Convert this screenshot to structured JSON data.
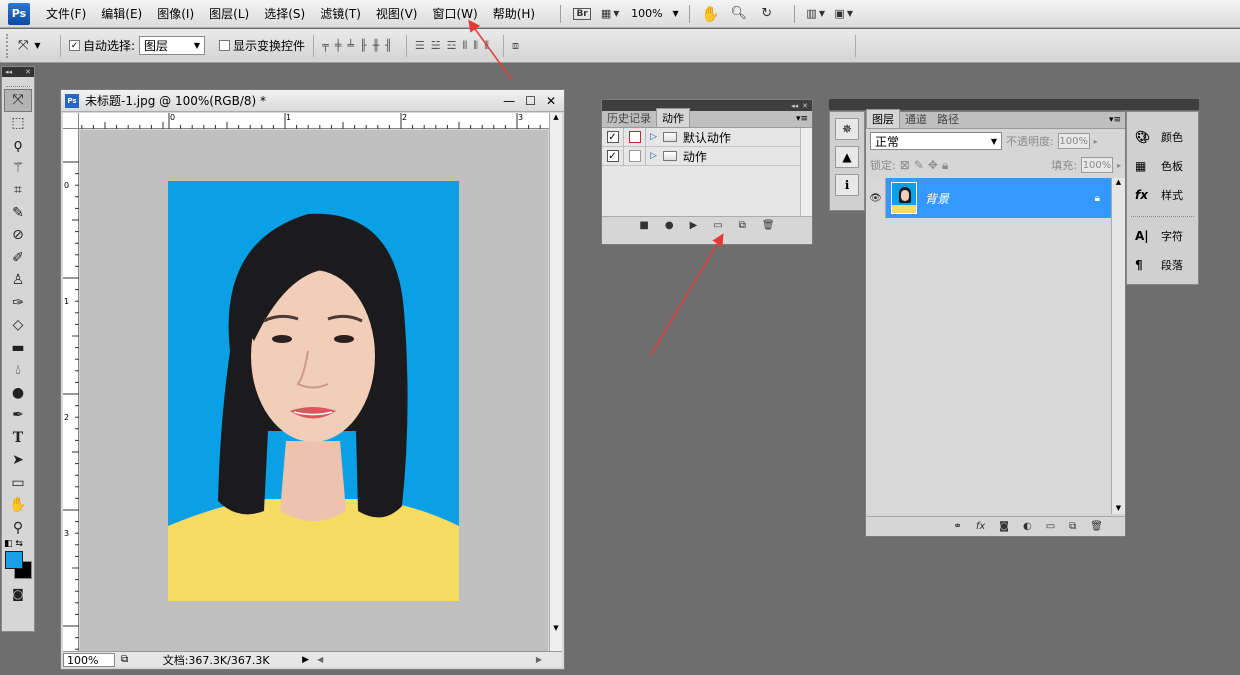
{
  "app": {
    "logo": "Ps"
  },
  "menu": [
    "文件(F)",
    "编辑(E)",
    "图像(I)",
    "图层(L)",
    "选择(S)",
    "滤镜(T)",
    "视图(V)",
    "窗口(W)",
    "帮助(H)"
  ],
  "menubar_tools": {
    "bridge": "Br",
    "zoom": "100%"
  },
  "options": {
    "auto_select_label": "自动选择:",
    "auto_select_value": "图层",
    "show_transform_label": "显示变换控件"
  },
  "document": {
    "title": "未标题-1.jpg @ 100%(RGB/8) *",
    "ruler_h": [
      "0",
      "1",
      "2",
      "3"
    ],
    "ruler_v": [
      "0",
      "1",
      "2",
      "3"
    ],
    "zoom": "100%",
    "status": "文档:367.3K/367.3K"
  },
  "actions_panel": {
    "tabs": [
      "历史记录",
      "动作"
    ],
    "active_tab": "动作",
    "rows": [
      "默认动作",
      "动作"
    ]
  },
  "layers_panel": {
    "tabs": [
      "图层",
      "通道",
      "路径"
    ],
    "blend_mode": "正常",
    "opacity_label": "不透明度:",
    "opacity": "100%",
    "lock_label": "锁定:",
    "fill_label": "填充:",
    "fill": "100%",
    "layers": [
      {
        "name": "背景",
        "selected": true,
        "locked": true
      }
    ]
  },
  "side_panel": {
    "items": [
      "颜色",
      "色板",
      "样式",
      "字符",
      "段落"
    ]
  },
  "colors": {
    "foreground": "#1aa0e8",
    "background": "#000000",
    "selection": "#3399ff",
    "photo_bg": "#0aa0e6",
    "shirt": "#f7dc64"
  }
}
